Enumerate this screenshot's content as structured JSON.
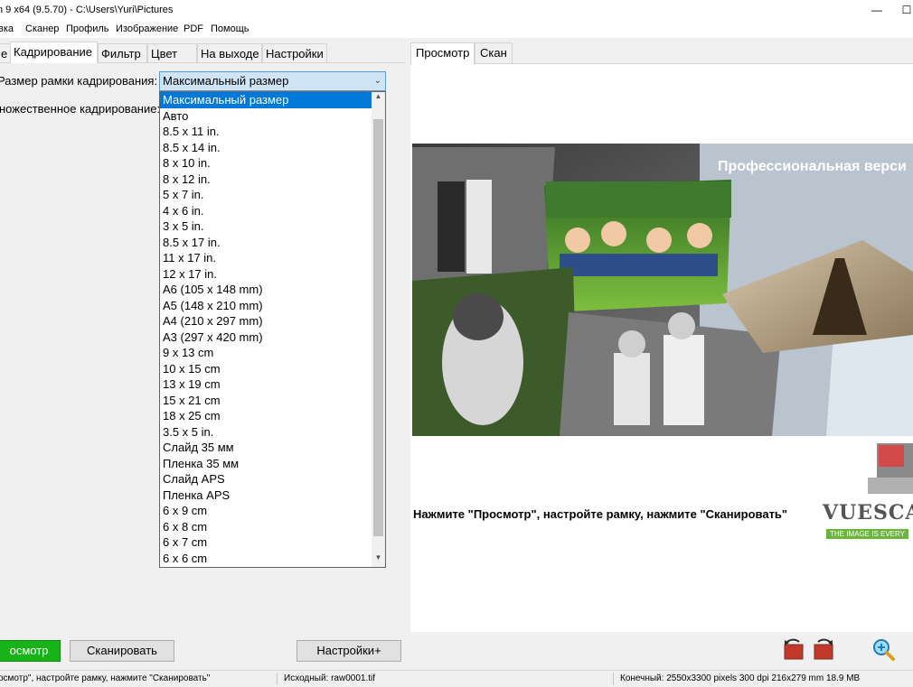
{
  "window": {
    "title": "n 9 x64 (9.5.70) - C:\\Users\\Yuri\\Pictures",
    "minimize_glyph": "—",
    "maximize_glyph": "☐"
  },
  "menu": [
    "вка",
    "Сканер",
    "Профиль",
    "Изображение",
    "PDF",
    "Помощь"
  ],
  "left_tabs": [
    "е",
    "Кадрирование",
    "Фильтр",
    "Цвет",
    "На выходе",
    "Настройки"
  ],
  "form": {
    "crop_size_label": "Размер рамки кадрирования:",
    "multi_crop_label": "ножественное кадрирование:",
    "crop_size_value": "Максимальный размер"
  },
  "crop_options": [
    "Максимальный размер",
    "Авто",
    "8.5 x 11 in.",
    "8.5 x 14 in.",
    "8 x 10 in.",
    "8 x 12 in.",
    "5 x 7 in.",
    "4 x 6 in.",
    "3 x 5 in.",
    "8.5 x 17 in.",
    "11 x 17 in.",
    "12 x 17 in.",
    "A6 (105 x 148 mm)",
    "A5 (148 x 210 mm)",
    "A4 (210 x 297 mm)",
    "A3 (297 x 420 mm)",
    "9 x 13 cm",
    "10 x 15 cm",
    "13 x 19 cm",
    "15 x 21 cm",
    "18 x 25 cm",
    "3.5 x 5 in.",
    "Слайд 35 мм",
    "Пленка 35 мм",
    "Слайд APS",
    "Пленка APS",
    "6 x 9 cm",
    "6 x 8 cm",
    "6 x 7 cm",
    "6 x 6 cm"
  ],
  "right_tabs": [
    "Просмотр",
    "Скан"
  ],
  "preview": {
    "banner_text": "Профессиональная верси",
    "hint": "Нажмите \"Просмотр\", настройте рамку, нажмите \"Сканировать\"",
    "logo": "VUESCA",
    "logo_tagline": "THE IMAGE IS EVERY"
  },
  "buttons": {
    "preview": "осмотр",
    "scan": "Сканировать",
    "settings": "Настройки+"
  },
  "status": {
    "left": "осмотр\", настройте рамку, нажмите \"Сканировать\"",
    "source": "Исходный: raw0001.tif",
    "final": "Конечный: 2550x3300 pixels 300 dpi 216x279 mm 18.9 MB"
  },
  "colors": {
    "accent": "#0078d7",
    "preview_button": "#18b318",
    "logo_green": "#6db33f"
  }
}
